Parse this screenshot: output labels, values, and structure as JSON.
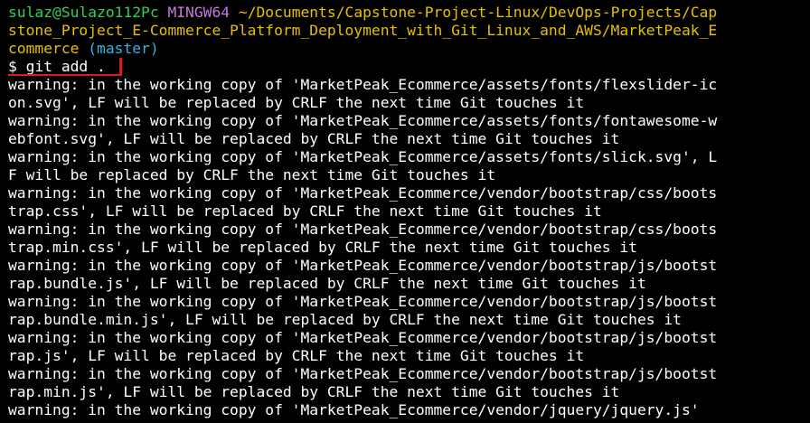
{
  "prompt": {
    "user_host": "sulaz@Sulazo112Pc",
    "system": "MINGW64",
    "path_line1": "~/Documents/Capstone-Project-Linux/DevOps-Projects/Cap",
    "path_line2": "stone_Project_E-Commerce_Platform_Deployment_with_Git_Linux_and_AWS/MarketPeak_E",
    "path_line3": "commerce",
    "branch": "(master)",
    "command": "$ git add ."
  },
  "output_lines": [
    "warning: in the working copy of 'MarketPeak_Ecommerce/assets/fonts/flexslider-ic",
    "on.svg', LF will be replaced by CRLF the next time Git touches it",
    "warning: in the working copy of 'MarketPeak_Ecommerce/assets/fonts/fontawesome-w",
    "ebfont.svg', LF will be replaced by CRLF the next time Git touches it",
    "warning: in the working copy of 'MarketPeak_Ecommerce/assets/fonts/slick.svg', L",
    "F will be replaced by CRLF the next time Git touches it",
    "warning: in the working copy of 'MarketPeak_Ecommerce/vendor/bootstrap/css/boots",
    "trap.css', LF will be replaced by CRLF the next time Git touches it",
    "warning: in the working copy of 'MarketPeak_Ecommerce/vendor/bootstrap/css/boots",
    "trap.min.css', LF will be replaced by CRLF the next time Git touches it",
    "warning: in the working copy of 'MarketPeak_Ecommerce/vendor/bootstrap/js/bootst",
    "rap.bundle.js', LF will be replaced by CRLF the next time Git touches it",
    "warning: in the working copy of 'MarketPeak_Ecommerce/vendor/bootstrap/js/bootst",
    "rap.bundle.min.js', LF will be replaced by CRLF the next time Git touches it",
    "warning: in the working copy of 'MarketPeak_Ecommerce/vendor/bootstrap/js/bootst",
    "rap.js', LF will be replaced by CRLF the next time Git touches it",
    "warning: in the working copy of 'MarketPeak_Ecommerce/vendor/bootstrap/js/bootst",
    "rap.min.js', LF will be replaced by CRLF the next time Git touches it",
    "warning: in the working copy of 'MarketPeak_Ecommerce/vendor/jquery/jquery.js'"
  ],
  "colors": {
    "background": "#000000",
    "user_host": "#30d158",
    "system": "#c678dd",
    "path": "#e5c100",
    "branch": "#33b5e5",
    "text": "#ffffff",
    "highlight": "#e0191e"
  }
}
